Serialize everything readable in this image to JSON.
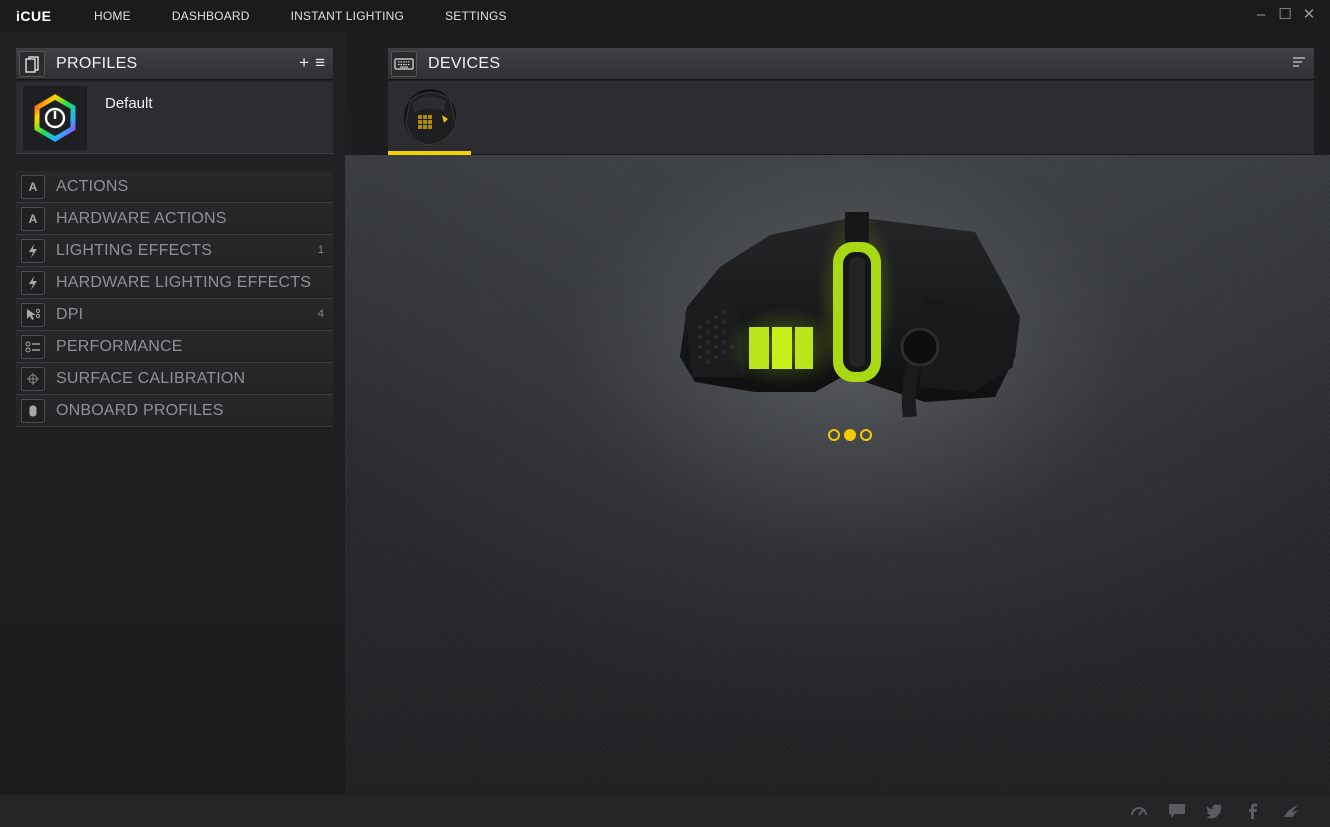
{
  "app": {
    "title": "iCUE"
  },
  "nav": {
    "items": [
      "HOME",
      "DASHBOARD",
      "INSTANT LIGHTING",
      "SETTINGS"
    ]
  },
  "window_controls": {
    "minimize": "–",
    "maximize": "☐",
    "close": "✕"
  },
  "profiles": {
    "title": "PROFILES",
    "add_label": "+",
    "menu_label": "≡",
    "items": [
      {
        "name": "Default"
      }
    ]
  },
  "menu": {
    "items": [
      {
        "label": "ACTIONS",
        "icon": "letter-a-icon",
        "count": ""
      },
      {
        "label": "HARDWARE ACTIONS",
        "icon": "letter-a-icon",
        "count": ""
      },
      {
        "label": "LIGHTING EFFECTS",
        "icon": "lightning-icon",
        "count": "1"
      },
      {
        "label": "HARDWARE LIGHTING EFFECTS",
        "icon": "lightning-icon",
        "count": ""
      },
      {
        "label": "DPI",
        "icon": "cursor-icon",
        "count": "4"
      },
      {
        "label": "PERFORMANCE",
        "icon": "sliders-icon",
        "count": ""
      },
      {
        "label": "SURFACE CALIBRATION",
        "icon": "crosshair-icon",
        "count": ""
      },
      {
        "label": "ONBOARD PROFILES",
        "icon": "mouse-icon",
        "count": ""
      }
    ]
  },
  "devices": {
    "title": "DEVICES",
    "selected_index": 0,
    "device_count": 1
  },
  "pager": {
    "pages": 3,
    "active": 1
  },
  "footer": {
    "icons": [
      "speedometer-icon",
      "chat-icon",
      "twitter-icon",
      "facebook-icon",
      "corsair-sails-icon"
    ]
  },
  "colors": {
    "accent": "#f5d000",
    "lighting_glow": "#c6f21a",
    "background": "#1b1d1f"
  }
}
